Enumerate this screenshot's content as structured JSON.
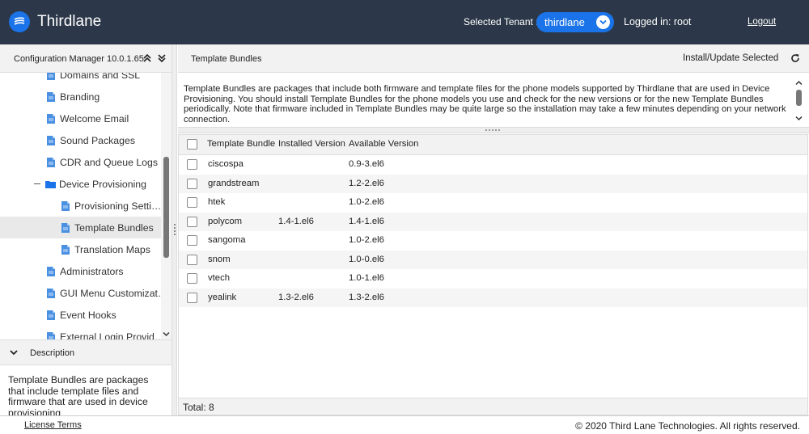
{
  "header": {
    "app_title": "Thirdlane",
    "tenant_label": "Selected Tenant :",
    "tenant_value": "thirdlane",
    "logged_in": "Logged in: root",
    "logout": "Logout",
    "accent": "#1a73e8",
    "bg": "#2c3849"
  },
  "left_panel": {
    "title": "Configuration Manager 10.0.1.65",
    "tree": [
      {
        "label": "Domains and SSL",
        "level": 1,
        "type": "doc",
        "selected": false
      },
      {
        "label": "Branding",
        "level": 1,
        "type": "doc",
        "selected": false
      },
      {
        "label": "Welcome Email",
        "level": 1,
        "type": "doc",
        "selected": false
      },
      {
        "label": "Sound Packages",
        "level": 1,
        "type": "doc",
        "selected": false
      },
      {
        "label": "CDR and Queue Logs",
        "level": 1,
        "type": "doc",
        "selected": false
      },
      {
        "label": "Device Provisioning",
        "level": 1,
        "type": "folder",
        "selected": false
      },
      {
        "label": "Provisioning Setti…",
        "level": 2,
        "type": "doc",
        "selected": false
      },
      {
        "label": "Template Bundles",
        "level": 2,
        "type": "doc",
        "selected": true
      },
      {
        "label": "Translation Maps",
        "level": 2,
        "type": "doc",
        "selected": false
      },
      {
        "label": "Administrators",
        "level": 1,
        "type": "doc",
        "selected": false
      },
      {
        "label": "GUI Menu Customizat…",
        "level": 1,
        "type": "doc",
        "selected": false
      },
      {
        "label": "Event Hooks",
        "level": 1,
        "type": "doc",
        "selected": false
      },
      {
        "label": "External Login Provid…",
        "level": 1,
        "type": "doc",
        "selected": false
      }
    ],
    "description_title": "Description",
    "description_text": "Template Bundles are packages that include template files and firmware that are used in device provisioning"
  },
  "main": {
    "title": "Template Bundles",
    "install_button": "Install/Update Selected",
    "intro": "Template Bundles are packages that include both firmware and template files for the phone models supported by Thirdlane that are used in Device Provisioning. You should install Template Bundles for the phone models you use and check for the new versions or for the new Template Bundles periodically. Note that firmware included in Template Bundles may be quite large so the installation may take a few minutes depending on your network connection.",
    "columns": [
      "Template Bundle",
      "Installed Version",
      "Available Version"
    ],
    "rows": [
      {
        "name": "ciscospa",
        "installed": "",
        "available": "0.9-3.el6"
      },
      {
        "name": "grandstream",
        "installed": "",
        "available": "1.2-2.el6"
      },
      {
        "name": "htek",
        "installed": "",
        "available": "1.0-2.el6"
      },
      {
        "name": "polycom",
        "installed": "1.4-1.el6",
        "available": "1.4-1.el6"
      },
      {
        "name": "sangoma",
        "installed": "",
        "available": "1.0-2.el6"
      },
      {
        "name": "snom",
        "installed": "",
        "available": "1.0-0.el6"
      },
      {
        "name": "vtech",
        "installed": "",
        "available": "1.0-1.el6"
      },
      {
        "name": "yealink",
        "installed": "1.3-2.el6",
        "available": "1.3-2.el6"
      }
    ],
    "total": "Total: 8"
  },
  "footer": {
    "license": "License Terms",
    "copyright": "© 2020 Third Lane Technologies. All rights reserved."
  }
}
